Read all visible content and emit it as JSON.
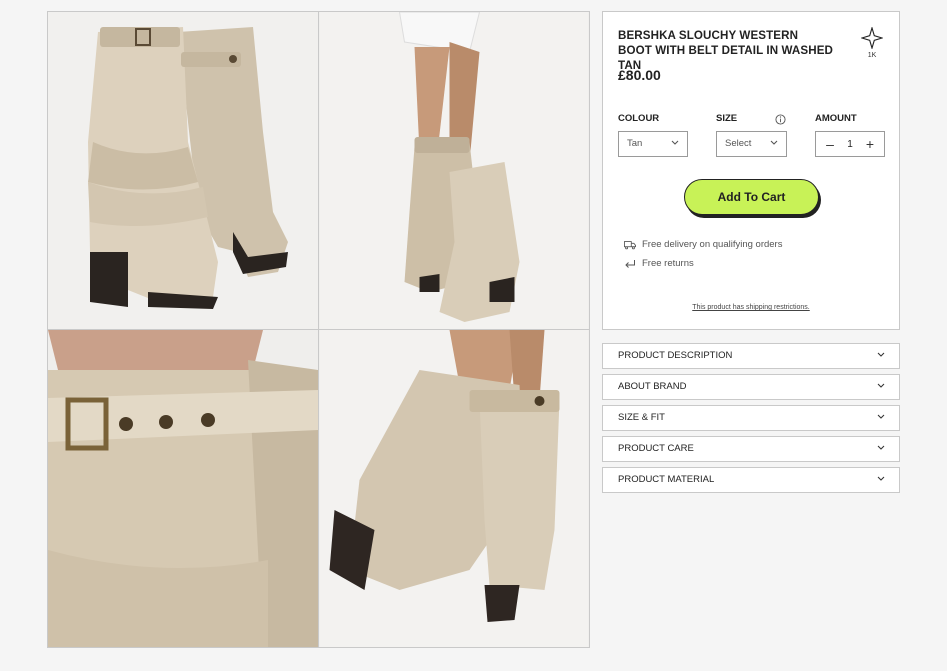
{
  "gallery": {
    "images": [
      {
        "alt": "Pair of tan slouchy western boots with belt detail, front view"
      },
      {
        "alt": "Model wearing tan slouchy western boots, side view"
      },
      {
        "alt": "Close up of buckled belt detail on boot shaft"
      },
      {
        "alt": "Model walking in tan slouchy boots, back view"
      }
    ]
  },
  "product": {
    "title": "BERSHKA SLOUCHY WESTERN BOOT WITH BELT DETAIL IN WASHED TAN",
    "save_count": "1K",
    "price": "£80.00"
  },
  "options": {
    "colour_label": "COLOUR",
    "colour_value": "Tan",
    "size_label": "SIZE",
    "size_value": "Select",
    "amount_label": "AMOUNT",
    "amount_value": "1",
    "minus": "–",
    "plus": "+"
  },
  "cart": {
    "label": "Add To Cart"
  },
  "perks": {
    "delivery": "Free delivery on qualifying orders",
    "returns": "Free returns"
  },
  "restriction_text": "This product has shipping restrictions.",
  "accordion": [
    {
      "label": "PRODUCT DESCRIPTION"
    },
    {
      "label": "ABOUT BRAND"
    },
    {
      "label": "SIZE & FIT"
    },
    {
      "label": "PRODUCT CARE"
    },
    {
      "label": "PRODUCT MATERIAL"
    }
  ],
  "colors": {
    "accent_button": "#c8f257",
    "boot_tan": "#d9cdb8",
    "border": "#c9c9c9"
  }
}
